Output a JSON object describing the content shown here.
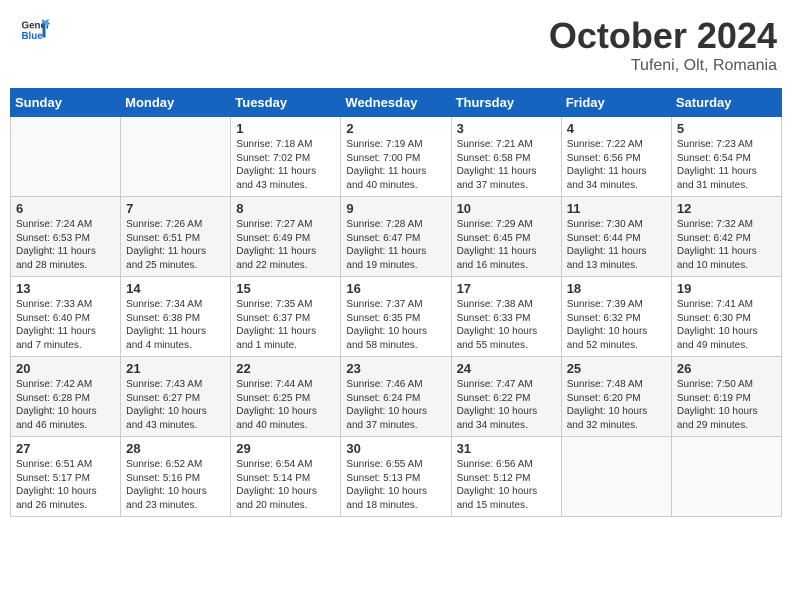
{
  "header": {
    "logo_general": "General",
    "logo_blue": "Blue",
    "month_title": "October 2024",
    "location": "Tufeni, Olt, Romania"
  },
  "days_of_week": [
    "Sunday",
    "Monday",
    "Tuesday",
    "Wednesday",
    "Thursday",
    "Friday",
    "Saturday"
  ],
  "weeks": [
    [
      {
        "num": "",
        "sunrise": "",
        "sunset": "",
        "daylight": "",
        "empty": true
      },
      {
        "num": "",
        "sunrise": "",
        "sunset": "",
        "daylight": "",
        "empty": true
      },
      {
        "num": "1",
        "sunrise": "Sunrise: 7:18 AM",
        "sunset": "Sunset: 7:02 PM",
        "daylight": "Daylight: 11 hours and 43 minutes."
      },
      {
        "num": "2",
        "sunrise": "Sunrise: 7:19 AM",
        "sunset": "Sunset: 7:00 PM",
        "daylight": "Daylight: 11 hours and 40 minutes."
      },
      {
        "num": "3",
        "sunrise": "Sunrise: 7:21 AM",
        "sunset": "Sunset: 6:58 PM",
        "daylight": "Daylight: 11 hours and 37 minutes."
      },
      {
        "num": "4",
        "sunrise": "Sunrise: 7:22 AM",
        "sunset": "Sunset: 6:56 PM",
        "daylight": "Daylight: 11 hours and 34 minutes."
      },
      {
        "num": "5",
        "sunrise": "Sunrise: 7:23 AM",
        "sunset": "Sunset: 6:54 PM",
        "daylight": "Daylight: 11 hours and 31 minutes."
      }
    ],
    [
      {
        "num": "6",
        "sunrise": "Sunrise: 7:24 AM",
        "sunset": "Sunset: 6:53 PM",
        "daylight": "Daylight: 11 hours and 28 minutes."
      },
      {
        "num": "7",
        "sunrise": "Sunrise: 7:26 AM",
        "sunset": "Sunset: 6:51 PM",
        "daylight": "Daylight: 11 hours and 25 minutes."
      },
      {
        "num": "8",
        "sunrise": "Sunrise: 7:27 AM",
        "sunset": "Sunset: 6:49 PM",
        "daylight": "Daylight: 11 hours and 22 minutes."
      },
      {
        "num": "9",
        "sunrise": "Sunrise: 7:28 AM",
        "sunset": "Sunset: 6:47 PM",
        "daylight": "Daylight: 11 hours and 19 minutes."
      },
      {
        "num": "10",
        "sunrise": "Sunrise: 7:29 AM",
        "sunset": "Sunset: 6:45 PM",
        "daylight": "Daylight: 11 hours and 16 minutes."
      },
      {
        "num": "11",
        "sunrise": "Sunrise: 7:30 AM",
        "sunset": "Sunset: 6:44 PM",
        "daylight": "Daylight: 11 hours and 13 minutes."
      },
      {
        "num": "12",
        "sunrise": "Sunrise: 7:32 AM",
        "sunset": "Sunset: 6:42 PM",
        "daylight": "Daylight: 11 hours and 10 minutes."
      }
    ],
    [
      {
        "num": "13",
        "sunrise": "Sunrise: 7:33 AM",
        "sunset": "Sunset: 6:40 PM",
        "daylight": "Daylight: 11 hours and 7 minutes."
      },
      {
        "num": "14",
        "sunrise": "Sunrise: 7:34 AM",
        "sunset": "Sunset: 6:38 PM",
        "daylight": "Daylight: 11 hours and 4 minutes."
      },
      {
        "num": "15",
        "sunrise": "Sunrise: 7:35 AM",
        "sunset": "Sunset: 6:37 PM",
        "daylight": "Daylight: 11 hours and 1 minute."
      },
      {
        "num": "16",
        "sunrise": "Sunrise: 7:37 AM",
        "sunset": "Sunset: 6:35 PM",
        "daylight": "Daylight: 10 hours and 58 minutes."
      },
      {
        "num": "17",
        "sunrise": "Sunrise: 7:38 AM",
        "sunset": "Sunset: 6:33 PM",
        "daylight": "Daylight: 10 hours and 55 minutes."
      },
      {
        "num": "18",
        "sunrise": "Sunrise: 7:39 AM",
        "sunset": "Sunset: 6:32 PM",
        "daylight": "Daylight: 10 hours and 52 minutes."
      },
      {
        "num": "19",
        "sunrise": "Sunrise: 7:41 AM",
        "sunset": "Sunset: 6:30 PM",
        "daylight": "Daylight: 10 hours and 49 minutes."
      }
    ],
    [
      {
        "num": "20",
        "sunrise": "Sunrise: 7:42 AM",
        "sunset": "Sunset: 6:28 PM",
        "daylight": "Daylight: 10 hours and 46 minutes."
      },
      {
        "num": "21",
        "sunrise": "Sunrise: 7:43 AM",
        "sunset": "Sunset: 6:27 PM",
        "daylight": "Daylight: 10 hours and 43 minutes."
      },
      {
        "num": "22",
        "sunrise": "Sunrise: 7:44 AM",
        "sunset": "Sunset: 6:25 PM",
        "daylight": "Daylight: 10 hours and 40 minutes."
      },
      {
        "num": "23",
        "sunrise": "Sunrise: 7:46 AM",
        "sunset": "Sunset: 6:24 PM",
        "daylight": "Daylight: 10 hours and 37 minutes."
      },
      {
        "num": "24",
        "sunrise": "Sunrise: 7:47 AM",
        "sunset": "Sunset: 6:22 PM",
        "daylight": "Daylight: 10 hours and 34 minutes."
      },
      {
        "num": "25",
        "sunrise": "Sunrise: 7:48 AM",
        "sunset": "Sunset: 6:20 PM",
        "daylight": "Daylight: 10 hours and 32 minutes."
      },
      {
        "num": "26",
        "sunrise": "Sunrise: 7:50 AM",
        "sunset": "Sunset: 6:19 PM",
        "daylight": "Daylight: 10 hours and 29 minutes."
      }
    ],
    [
      {
        "num": "27",
        "sunrise": "Sunrise: 6:51 AM",
        "sunset": "Sunset: 5:17 PM",
        "daylight": "Daylight: 10 hours and 26 minutes."
      },
      {
        "num": "28",
        "sunrise": "Sunrise: 6:52 AM",
        "sunset": "Sunset: 5:16 PM",
        "daylight": "Daylight: 10 hours and 23 minutes."
      },
      {
        "num": "29",
        "sunrise": "Sunrise: 6:54 AM",
        "sunset": "Sunset: 5:14 PM",
        "daylight": "Daylight: 10 hours and 20 minutes."
      },
      {
        "num": "30",
        "sunrise": "Sunrise: 6:55 AM",
        "sunset": "Sunset: 5:13 PM",
        "daylight": "Daylight: 10 hours and 18 minutes."
      },
      {
        "num": "31",
        "sunrise": "Sunrise: 6:56 AM",
        "sunset": "Sunset: 5:12 PM",
        "daylight": "Daylight: 10 hours and 15 minutes."
      },
      {
        "num": "",
        "sunrise": "",
        "sunset": "",
        "daylight": "",
        "empty": true
      },
      {
        "num": "",
        "sunrise": "",
        "sunset": "",
        "daylight": "",
        "empty": true
      }
    ]
  ]
}
